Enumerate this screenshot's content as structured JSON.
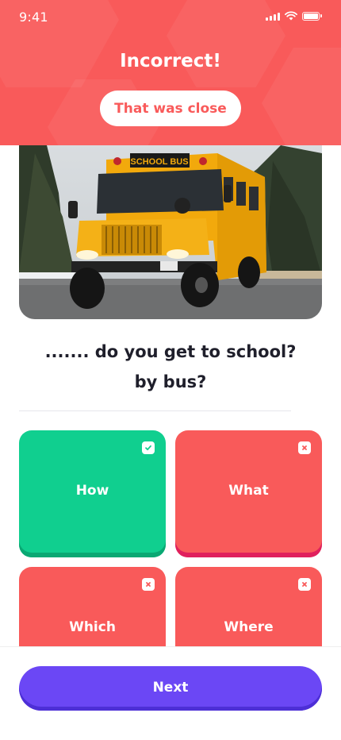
{
  "status_bar": {
    "time": "9:41",
    "icons": [
      "cellular-signal-icon",
      "wifi-icon",
      "battery-icon"
    ]
  },
  "result": {
    "title": "Incorrect!",
    "feedback": "That was close"
  },
  "image": {
    "subject": "school-bus-photo",
    "sign_text": "SCHOOL BUS"
  },
  "question": {
    "line1": "....... do you get to school?",
    "line2": "by bus?"
  },
  "options": [
    {
      "label": "How",
      "state": "correct",
      "badge_icon": "check-icon"
    },
    {
      "label": "What",
      "state": "wrong",
      "badge_icon": "close-icon"
    },
    {
      "label": "Which",
      "state": "wrong",
      "badge_icon": "close-icon"
    },
    {
      "label": "Where",
      "state": "wrong",
      "badge_icon": "close-icon"
    }
  ],
  "footer": {
    "next_label": "Next"
  },
  "colors": {
    "header": "#f95a5a",
    "correct": "#10cf8f",
    "wrong": "#f95a5a",
    "primary": "#6b47f5"
  }
}
